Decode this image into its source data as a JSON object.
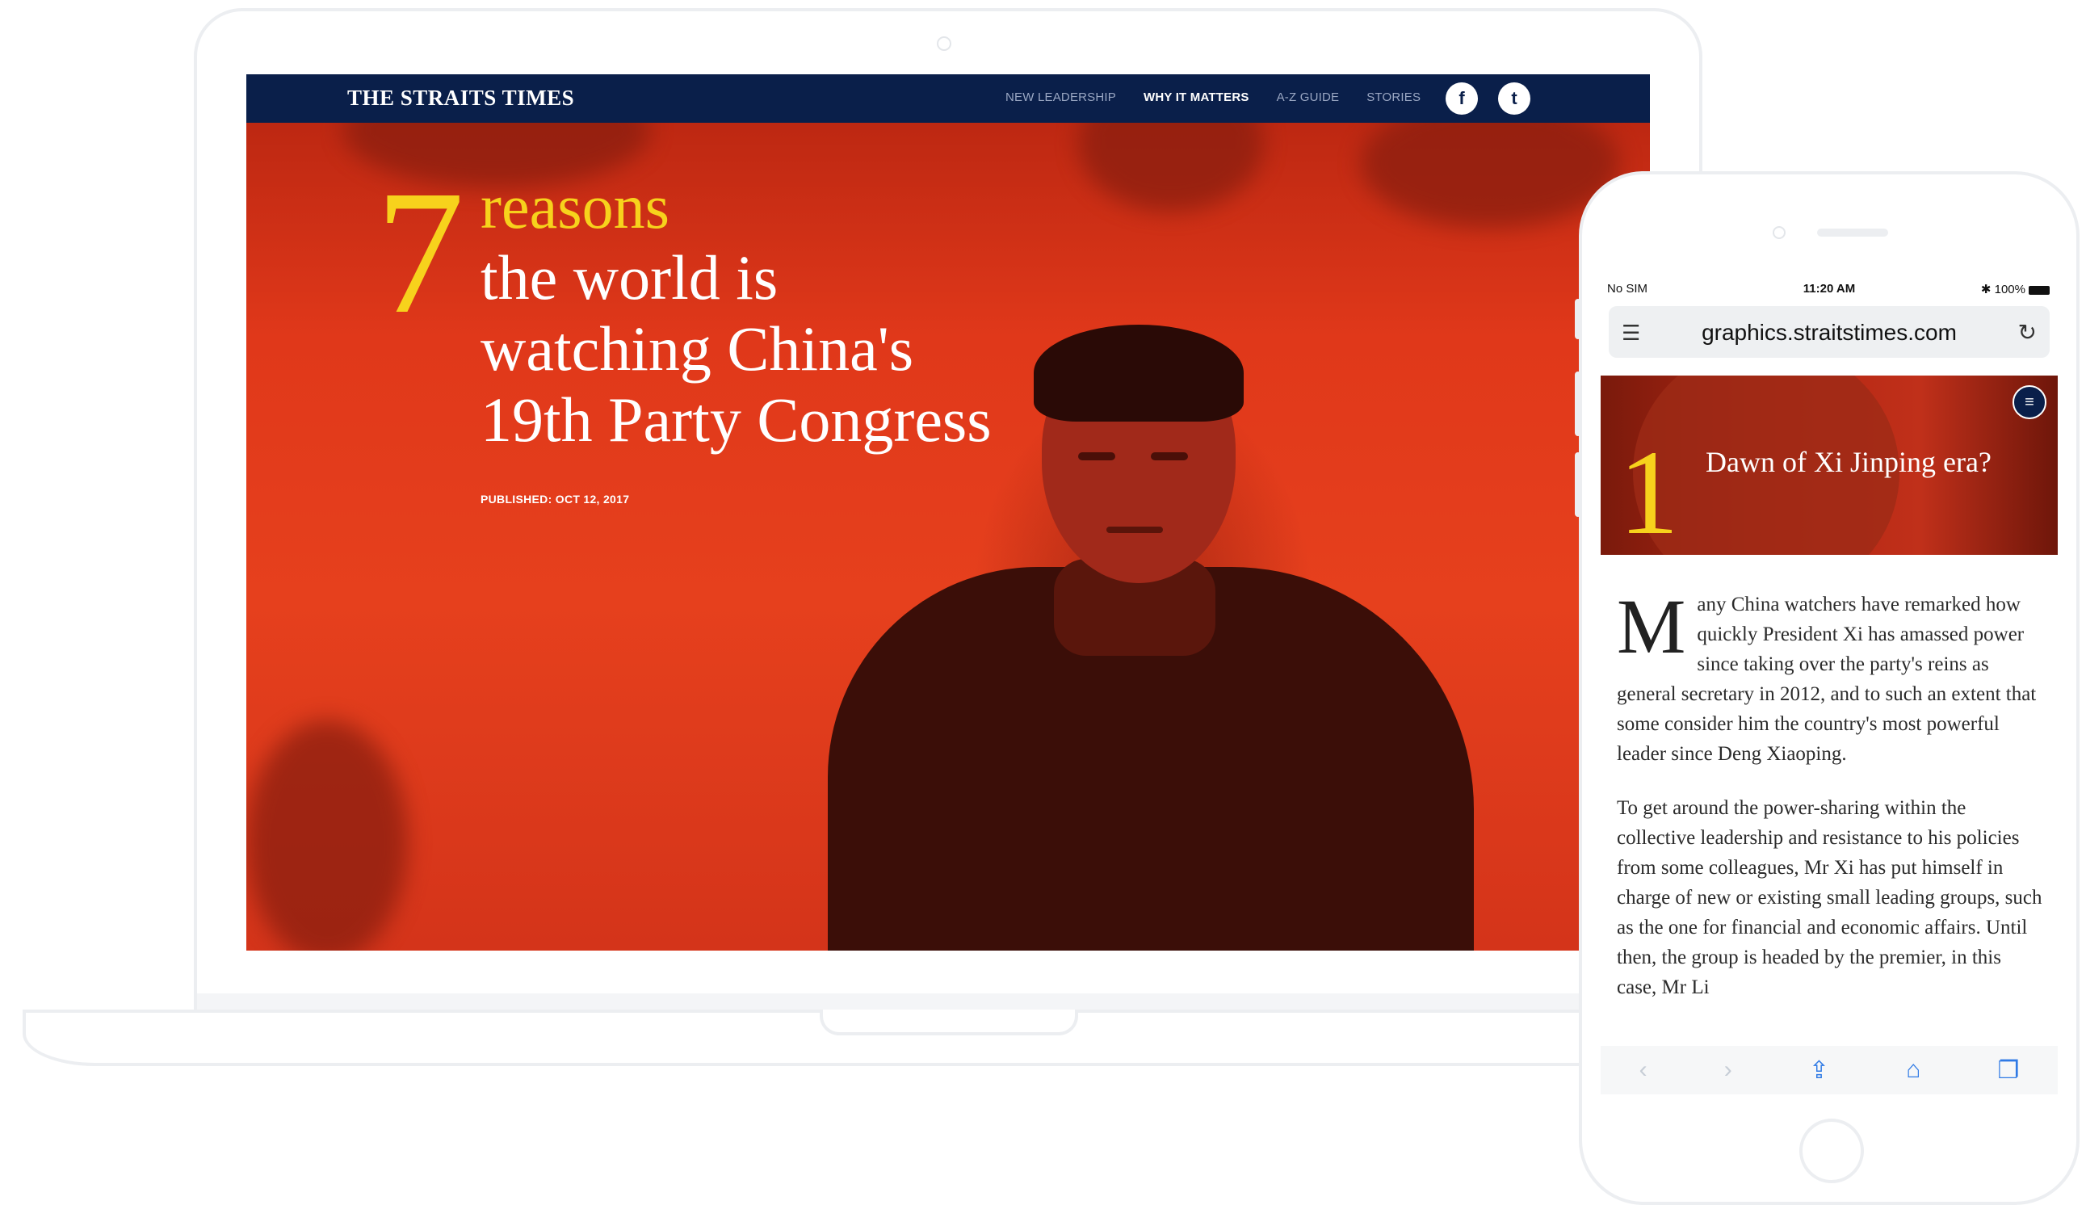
{
  "laptop": {
    "site": {
      "logo": "THE STRAITS TIMES",
      "nav": [
        {
          "label": "NEW LEADERSHIP",
          "active": false
        },
        {
          "label": "WHY IT MATTERS",
          "active": true
        },
        {
          "label": "A-Z GUIDE",
          "active": false
        },
        {
          "label": "STORIES",
          "active": false
        }
      ],
      "social": {
        "facebook": "f",
        "twitter": "t"
      }
    },
    "hero": {
      "number": "7",
      "reasons": "reasons",
      "lines": [
        "the world is",
        "watching China's",
        "19th Party Congress"
      ],
      "published": "PUBLISHED: OCT 12, 2017"
    }
  },
  "phone": {
    "status": {
      "carrier": "No SIM",
      "time": "11:20 AM",
      "battery": "100%"
    },
    "url": "graphics.straitstimes.com",
    "hero": {
      "number": "1",
      "title": "Dawn of Xi Jinping era?"
    },
    "article": {
      "dropcap": "M",
      "p1": "any China watchers have remarked how quickly President Xi has amassed power since taking over the party's reins as general secretary in 2012, and to such an extent that some consider him the country's most powerful leader since Deng Xiaoping.",
      "p2": "To get around the power-sharing within the collective leadership and resistance to his policies from some colleagues, Mr Xi has put himself in charge of new or existing small leading groups, such as the one for financial and economic affairs. Until then, the group is headed by the premier, in this case, Mr Li"
    },
    "toolbar": {
      "back": "‹",
      "forward": "›",
      "share": "⇪",
      "bookmarks": "⌂",
      "tabs": "❐"
    }
  },
  "colors": {
    "navy": "#0a1f4a",
    "accent": "#f7d21c",
    "hero_red": "#e0381a"
  }
}
